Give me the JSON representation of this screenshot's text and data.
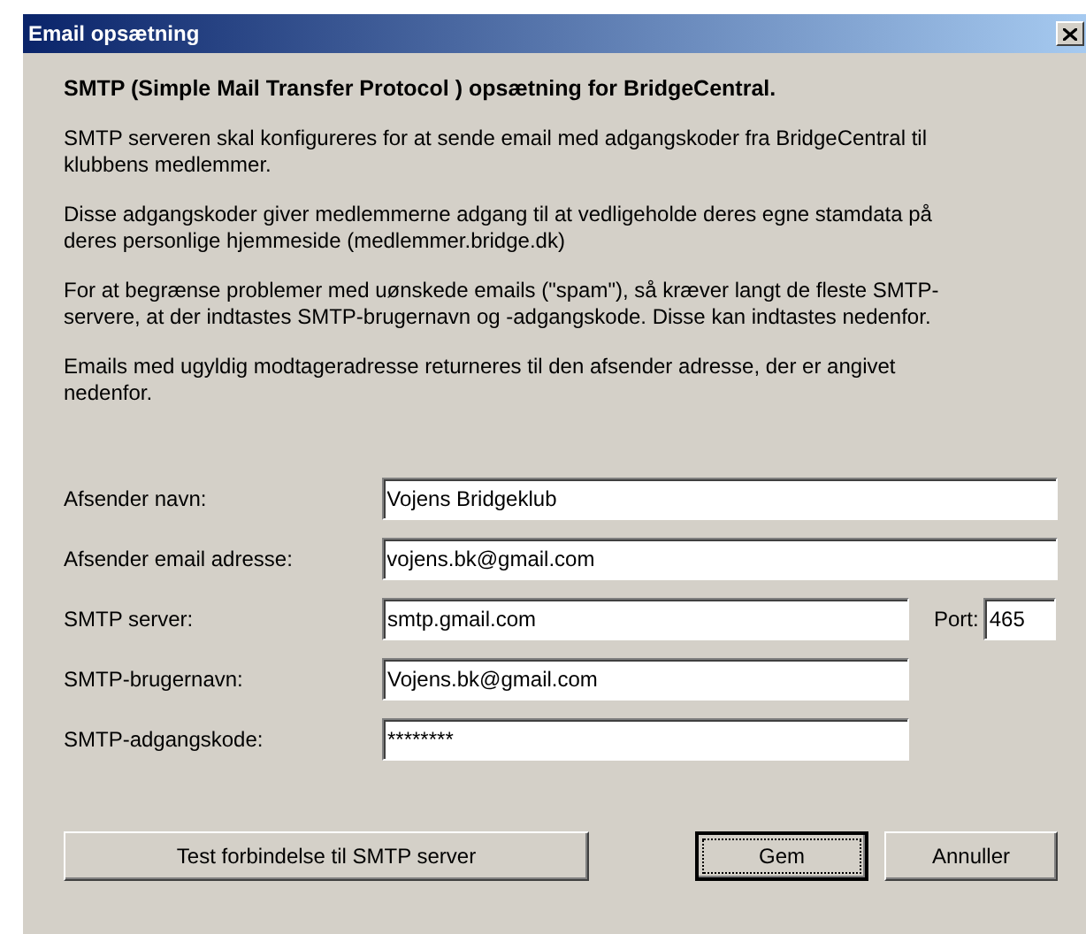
{
  "window": {
    "title": "Email opsætning"
  },
  "heading": "SMTP (Simple Mail Transfer Protocol ) opsætning for BridgeCentral.",
  "paragraphs": [
    "SMTP serveren skal konfigureres for at sende email med adgangskoder fra BridgeCentral til klubbens medlemmer.",
    "Disse adgangskoder giver medlemmerne adgang til at vedligeholde deres egne stamdata på deres personlige hjemmeside (medlemmer.bridge.dk)",
    "For at begrænse problemer med uønskede emails (\"spam\"), så kræver langt de fleste SMTP-servere, at der indtastes SMTP-brugernavn og -adgangskode.  Disse kan indtastes nedenfor.",
    "Emails med ugyldig modtageradresse returneres til den afsender adresse, der er angivet nedenfor."
  ],
  "fields": [
    {
      "label": "Afsender navn:",
      "value": "Vojens Bridgeklub"
    },
    {
      "label": "Afsender email adresse:",
      "value": "vojens.bk@gmail.com"
    },
    {
      "label": "SMTP server:",
      "value": "smtp.gmail.com",
      "port": {
        "label": "Port:",
        "value": "465"
      }
    },
    {
      "label": "SMTP-brugernavn:",
      "value": "Vojens.bk@gmail.com"
    },
    {
      "label": "SMTP-adgangskode:",
      "value": "********"
    }
  ],
  "buttons": [
    {
      "label": "Test forbindelse til SMTP server",
      "default": false
    },
    {
      "label": "Gem",
      "default": true
    },
    {
      "label": "Annuller",
      "default": false
    }
  ]
}
